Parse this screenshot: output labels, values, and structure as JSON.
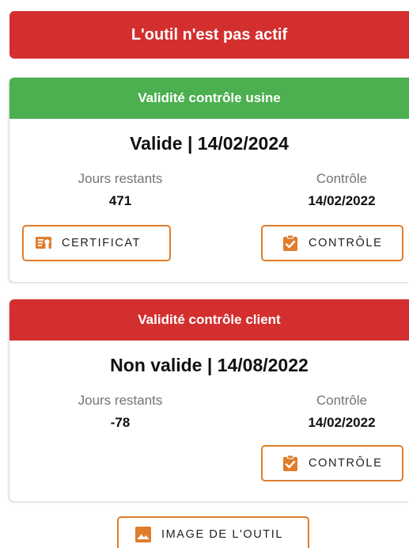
{
  "status_banner": {
    "text": "L'outil n'est pas actif",
    "color": "#d32f2f"
  },
  "factory_card": {
    "header": "Validité contrôle usine",
    "header_color": "#4caf50",
    "status": "Valide | 14/02/2024",
    "days_label": "Jours restants",
    "days_value": "471",
    "control_label": "Contrôle",
    "control_value": "14/02/2022",
    "certificate_button": "CERTIFICAT",
    "control_button": "CONTRÔLE"
  },
  "client_card": {
    "header": "Validité contrôle client",
    "header_color": "#d32f2f",
    "status": "Non valide | 14/08/2022",
    "days_label": "Jours restants",
    "days_value": "-78",
    "control_label": "Contrôle",
    "control_value": "14/02/2022",
    "control_button": "CONTRÔLE"
  },
  "image_button": {
    "label": "IMAGE DE L'OUTIL"
  },
  "colors": {
    "accent": "#e07d2c",
    "valid": "#4caf50",
    "invalid": "#d32f2f"
  }
}
